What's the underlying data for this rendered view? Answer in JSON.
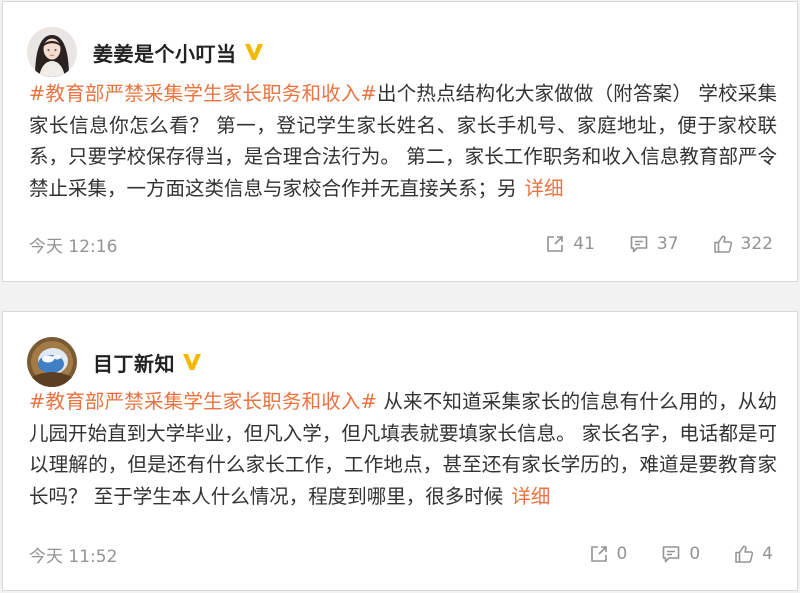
{
  "posts": [
    {
      "username": "姜姜是个小叮当",
      "hashtag": "#教育部严禁采集学生家长职务和收入#",
      "text": "出个热点结构化大家做做（附答案） 学校采集家长信息你怎么看？ 第一，登记学生家长姓名、家长手机号、家庭地址，便于家校联系，只要学校保存得当，是合理合法行为。 第二，家长工作职务和收入信息教育部严令禁止采集，一方面这类信息与家校合作并无直接关系；另",
      "more_label": "详细",
      "time": "今天 12:16",
      "share_count": "41",
      "comment_count": "37",
      "like_count": "322"
    },
    {
      "username": "目丁新知",
      "hashtag": "#教育部严禁采集学生家长职务和收入#",
      "text": " 从来不知道采集家长的信息有什么用的，从幼儿园开始直到大学毕业，但凡入学，但凡填表就要填家长信息。 家长名字，电话都是可以理解的，但是还有什么家长工作，工作地点，甚至还有家长学历的，难道是要教育家长吗？ 至于学生本人什么情况，程度到哪里，很多时候",
      "more_label": "详细",
      "time": "今天 11:52",
      "share_count": "0",
      "comment_count": "0",
      "like_count": "4"
    }
  ],
  "colors": {
    "hashtag": "#eb7340",
    "verified_badge": "#f5b800",
    "meta_text": "#939393"
  },
  "icons": {
    "verified": "verified-v-badge-icon",
    "share": "share-icon",
    "comment": "comment-icon",
    "like": "thumbs-up-icon"
  }
}
